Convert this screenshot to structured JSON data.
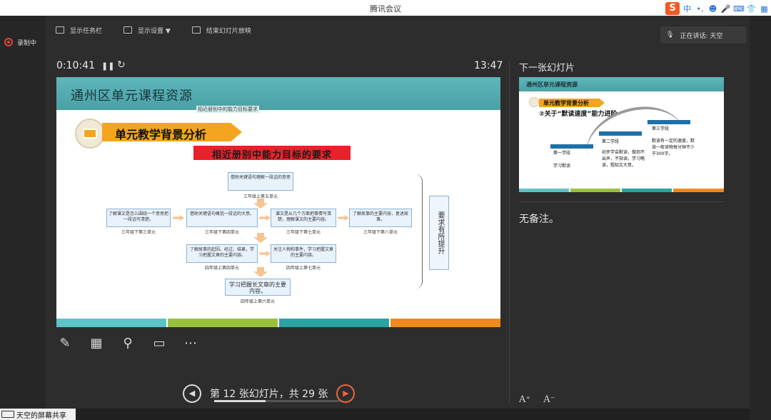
{
  "window": {
    "title": "腾讯会议"
  },
  "ime": {
    "brand": "S",
    "items": [
      "中",
      "•,",
      "☻",
      "🎤",
      "⌨",
      "👕",
      "▦"
    ]
  },
  "recording": {
    "label": "录制中"
  },
  "toolbar": {
    "items": [
      "显示任务栏",
      "显示设置 ▼",
      "结束幻灯片放映"
    ]
  },
  "speaker": {
    "label": "正在讲话: 天空"
  },
  "timer": {
    "elapsed": "0:10:41",
    "clock": "13:47"
  },
  "slide": {
    "header": "通州区单元课程资源",
    "subnote": "相近册别中的能力目标要求",
    "section_title": "单元教学背景分析",
    "requirement": "相近册别中能力目标的要求",
    "boxes": [
      {
        "text": "借助关键语句理解一段话的意思",
        "caption": "三年级上第五单元"
      },
      {
        "text": "了解课文是怎么围绕一个意思把一段话写清楚。",
        "caption": "三年级下第三单元"
      },
      {
        "text": "借助关键语句概括一段话的大意。",
        "caption": "三年级下第四单元"
      },
      {
        "text": "课文是从几个方面把事情写清楚，理解课文的主要内容。",
        "caption": "三年级下第七单元"
      },
      {
        "text": "了解故事的主要内容，复述故事。",
        "caption": "三年级下第八单元"
      },
      {
        "text": "了解故事的起因、经过、结果，学习把握文章的主要内容。",
        "caption": "四年级上第四单元"
      },
      {
        "text": "关注人物和事件，学习把握文章的主要内容。",
        "caption": "四年级上第七单元"
      },
      {
        "text": "学习把握长文章的主要内容。",
        "caption": "四年级上第六单元"
      }
    ],
    "goal": "要求有所提升",
    "strip_colors": [
      "#5cc3c8",
      "#99c23c",
      "#2aa3a3",
      "#f08a1d"
    ]
  },
  "controls": {
    "tools": [
      "pen-icon",
      "layout-icon",
      "search-icon",
      "screen-icon",
      "more-icon"
    ],
    "prev": "◀",
    "next": "▶",
    "counter": "第 12 张幻灯片，共 29 张",
    "progress": 0.41
  },
  "next_panel": {
    "title": "下一张幻灯片",
    "thumb_title": "通州区单元课程资源",
    "section": "单元教学背景分析",
    "subtitle": "②关于“默读速度”能力进阶",
    "stages": [
      {
        "name": "第一学段",
        "desc": "学习默读"
      },
      {
        "name": "第二学段",
        "desc": "初步学会默读，做到不出声，不指读。学习略读，粗知文大意。"
      },
      {
        "name": "第三学段",
        "desc": "默读有一定的速度，默读一般读物每分钟不少于300字。"
      }
    ]
  },
  "notes": {
    "text": "无备注。"
  },
  "font_ctrls": [
    "A⁺",
    "A⁻"
  ],
  "share": {
    "label": "天空的屏幕共享"
  }
}
